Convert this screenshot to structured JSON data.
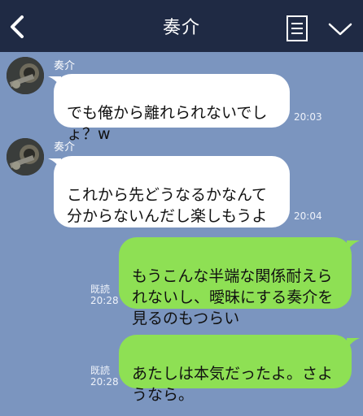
{
  "header": {
    "title": "奏介"
  },
  "messages": [
    {
      "sender": "奏介",
      "text": "でも俺から離れられないでしょ？w",
      "time": "20:03"
    },
    {
      "sender": "奏介",
      "text": "これから先どうなるかなんて分からないんだし楽しもうよ",
      "time": "20:04"
    },
    {
      "text": "もうこんな半端な関係耐えられないし、曖昧にする奏介を見るのもつらい",
      "read": "既読",
      "time": "20:28"
    },
    {
      "text": "あたしは本気だったよ。さようなら。",
      "read": "既読",
      "time": "20:28"
    }
  ],
  "colors": {
    "header": "#1f2a44",
    "background": "#7b95bf",
    "outgoing": "#8ee054",
    "incoming": "#ffffff"
  },
  "icons": [
    "back-icon",
    "memo-icon",
    "chevron-down-icon",
    "avatar"
  ]
}
